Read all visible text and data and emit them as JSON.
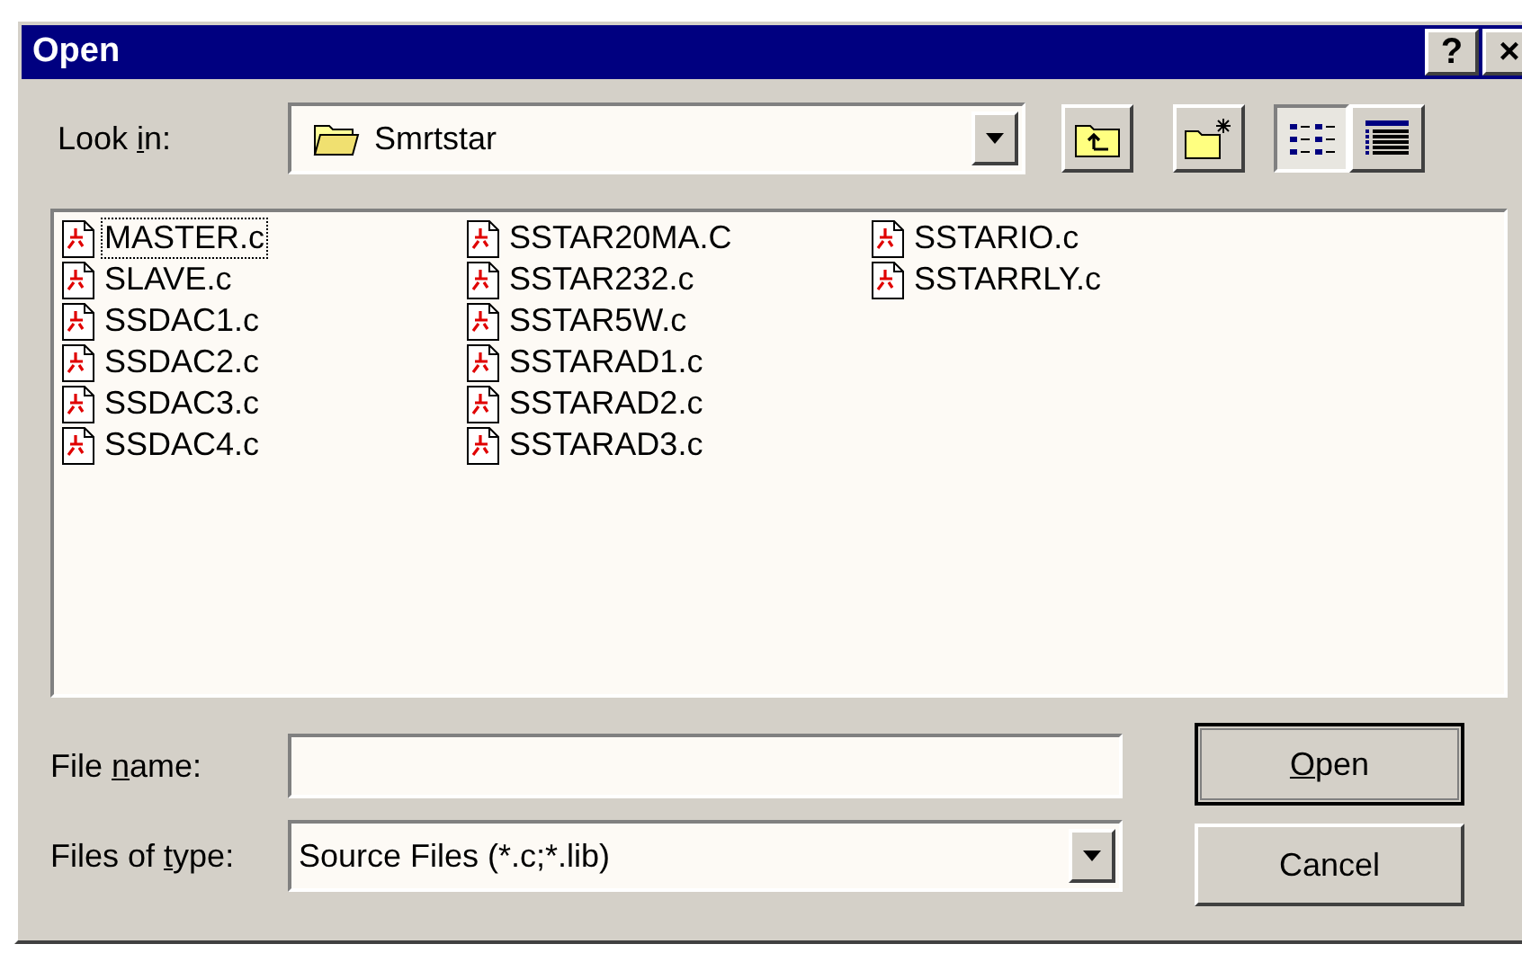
{
  "window": {
    "title": "Open",
    "title_buttons": [
      "?",
      "×"
    ]
  },
  "look_in": {
    "label": {
      "pre": "Look ",
      "key": "i",
      "post": "n:"
    },
    "value": "Smrtstar"
  },
  "toolbar": [
    {
      "kind": "up",
      "selected": false
    },
    {
      "kind": "new-folder",
      "selected": false
    },
    {
      "kind": "list",
      "selected": true
    },
    {
      "kind": "details",
      "selected": false
    }
  ],
  "files": [
    [
      {
        "name": "MASTER.c",
        "focused": true
      },
      {
        "name": "SLAVE.c",
        "focused": false
      },
      {
        "name": "SSDAC1.c",
        "focused": false
      },
      {
        "name": "SSDAC2.c",
        "focused": false
      },
      {
        "name": "SSDAC3.c",
        "focused": false
      },
      {
        "name": "SSDAC4.c",
        "focused": false
      }
    ],
    [
      {
        "name": "SSTAR20MA.C",
        "focused": false
      },
      {
        "name": "SSTAR232.c",
        "focused": false
      },
      {
        "name": "SSTAR5W.c",
        "focused": false
      },
      {
        "name": "SSTARAD1.c",
        "focused": false
      },
      {
        "name": "SSTARAD2.c",
        "focused": false
      },
      {
        "name": "SSTARAD3.c",
        "focused": false
      }
    ],
    [
      {
        "name": "SSTARIO.c",
        "focused": false
      },
      {
        "name": "SSTARRLY.c",
        "focused": false
      }
    ]
  ],
  "file_name": {
    "label": {
      "pre": "File ",
      "key": "n",
      "post": "ame:"
    }
  },
  "file_type": {
    "label": {
      "pre": "Files of ",
      "key": "t",
      "post": "ype:"
    },
    "value": "Source Files (*.c;*.lib)"
  },
  "buttons": [
    {
      "label": {
        "key": "O",
        "post": "pen"
      },
      "default": true
    },
    {
      "label": {
        "pre": "Cancel"
      },
      "default": false
    }
  ]
}
